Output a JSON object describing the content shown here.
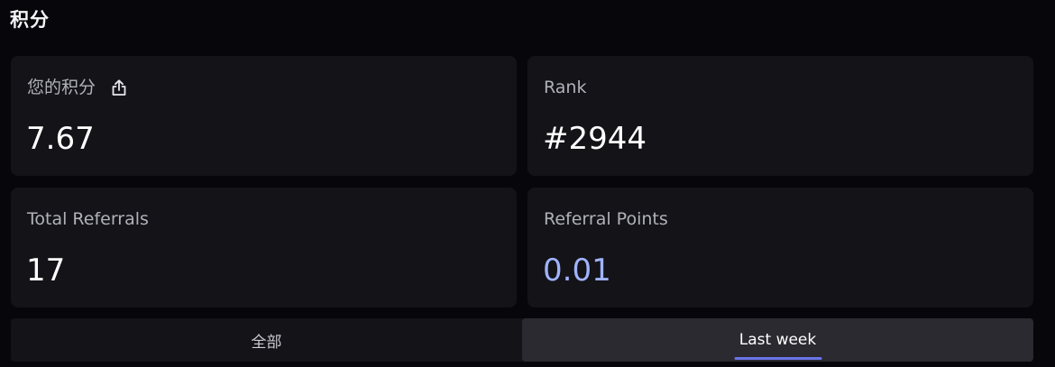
{
  "section": {
    "title": "积分"
  },
  "cards": {
    "points": {
      "label": "您的积分",
      "value": "7.67"
    },
    "rank": {
      "label": "Rank",
      "value": "#2944"
    },
    "total_referrals": {
      "label": "Total Referrals",
      "value": "17"
    },
    "referral_points": {
      "label": "Referral Points",
      "value": "0.01"
    }
  },
  "icons": {
    "share": "share-icon"
  },
  "tabs": [
    {
      "label": "全部",
      "active": false
    },
    {
      "label": "Last week",
      "active": true
    }
  ],
  "colors": {
    "accent_value": "#a0b3ff",
    "tab_indicator": "#6a74e8",
    "background": "#07070b",
    "card": "#131318"
  }
}
